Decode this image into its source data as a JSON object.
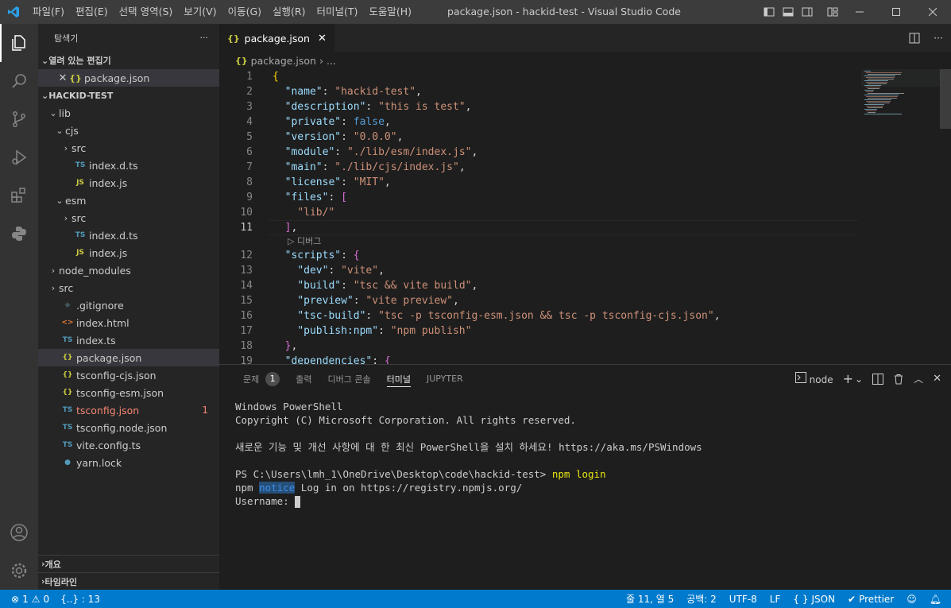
{
  "titlebar": {
    "title": "package.json - hackid-test - Visual Studio Code",
    "menu": [
      "파일(F)",
      "편집(E)",
      "선택 영역(S)",
      "보기(V)",
      "이동(G)",
      "실행(R)",
      "터미널(T)",
      "도움말(H)"
    ]
  },
  "sidebar": {
    "header": "탐색기",
    "more": "···",
    "open_editors_title": "열려 있는 편집기",
    "open_editor_item": "package.json",
    "workspace_title": "HACKID-TEST",
    "tree": [
      {
        "label": "lib",
        "kind": "folder-open",
        "depth": 0
      },
      {
        "label": "cjs",
        "kind": "folder-open",
        "depth": 1
      },
      {
        "label": "src",
        "kind": "folder",
        "depth": 2
      },
      {
        "label": "index.d.ts",
        "kind": "ts",
        "depth": 2
      },
      {
        "label": "index.js",
        "kind": "js",
        "depth": 2
      },
      {
        "label": "esm",
        "kind": "folder-open",
        "depth": 1
      },
      {
        "label": "src",
        "kind": "folder",
        "depth": 2
      },
      {
        "label": "index.d.ts",
        "kind": "ts",
        "depth": 2
      },
      {
        "label": "index.js",
        "kind": "js",
        "depth": 2
      },
      {
        "label": "node_modules",
        "kind": "folder",
        "depth": 0
      },
      {
        "label": "src",
        "kind": "folder",
        "depth": 0
      },
      {
        "label": ".gitignore",
        "kind": "git",
        "depth": 0
      },
      {
        "label": "index.html",
        "kind": "html",
        "depth": 0
      },
      {
        "label": "index.ts",
        "kind": "ts",
        "depth": 0
      },
      {
        "label": "package.json",
        "kind": "json",
        "depth": 0,
        "selected": true
      },
      {
        "label": "tsconfig-cjs.json",
        "kind": "json",
        "depth": 0
      },
      {
        "label": "tsconfig-esm.json",
        "kind": "json",
        "depth": 0
      },
      {
        "label": "tsconfig.json",
        "kind": "tsconfig",
        "depth": 0,
        "error": "1"
      },
      {
        "label": "tsconfig.node.json",
        "kind": "tsconfig",
        "depth": 0
      },
      {
        "label": "vite.config.ts",
        "kind": "ts",
        "depth": 0
      },
      {
        "label": "yarn.lock",
        "kind": "yarn",
        "depth": 0
      }
    ],
    "outline_title": "개요",
    "timeline_title": "타임라인"
  },
  "editor": {
    "tab_label": "package.json",
    "breadcrumb_file": "package.json",
    "breadcrumb_more": "...",
    "codelens": "디버그",
    "current_line": 11,
    "lines": [
      {
        "n": "1",
        "html": "<span class=\"br1\">{</span>"
      },
      {
        "n": "2",
        "html": "  <span class=\"k\">\"name\"</span><span class=\"p\">: </span><span class=\"s\">\"hackid-test\"</span><span class=\"p\">,</span>"
      },
      {
        "n": "3",
        "html": "  <span class=\"k\">\"description\"</span><span class=\"p\">: </span><span class=\"s\">\"this is test\"</span><span class=\"p\">,</span>"
      },
      {
        "n": "4",
        "html": "  <span class=\"k\">\"private\"</span><span class=\"p\">: </span><span class=\"b\">false</span><span class=\"p\">,</span>"
      },
      {
        "n": "5",
        "html": "  <span class=\"k\">\"version\"</span><span class=\"p\">: </span><span class=\"s\">\"0.0.0\"</span><span class=\"p\">,</span>"
      },
      {
        "n": "6",
        "html": "  <span class=\"k\">\"module\"</span><span class=\"p\">: </span><span class=\"s\">\"./lib/esm/index.js\"</span><span class=\"p\">,</span>"
      },
      {
        "n": "7",
        "html": "  <span class=\"k\">\"main\"</span><span class=\"p\">: </span><span class=\"s\">\"./lib/cjs/index.js\"</span><span class=\"p\">,</span>"
      },
      {
        "n": "8",
        "html": "  <span class=\"k\">\"license\"</span><span class=\"p\">: </span><span class=\"s\">\"MIT\"</span><span class=\"p\">,</span>"
      },
      {
        "n": "9",
        "html": "  <span class=\"k\">\"files\"</span><span class=\"p\">: </span><span class=\"br2\">[</span>"
      },
      {
        "n": "10",
        "html": "    <span class=\"s\">\"lib/\"</span>"
      },
      {
        "n": "11",
        "html": "  <span class=\"br2\">]</span><span class=\"p\">,</span>"
      },
      {
        "n": "12",
        "html": "  <span class=\"k\">\"scripts\"</span><span class=\"p\">: </span><span class=\"br2\">{</span>"
      },
      {
        "n": "13",
        "html": "    <span class=\"k\">\"dev\"</span><span class=\"p\">: </span><span class=\"s\">\"vite\"</span><span class=\"p\">,</span>"
      },
      {
        "n": "14",
        "html": "    <span class=\"k\">\"build\"</span><span class=\"p\">: </span><span class=\"s\">\"tsc &amp;&amp; vite build\"</span><span class=\"p\">,</span>"
      },
      {
        "n": "15",
        "html": "    <span class=\"k\">\"preview\"</span><span class=\"p\">: </span><span class=\"s\">\"vite preview\"</span><span class=\"p\">,</span>"
      },
      {
        "n": "16",
        "html": "    <span class=\"k\">\"tsc-build\"</span><span class=\"p\">: </span><span class=\"s\">\"tsc -p tsconfig-esm.json &amp;&amp; tsc -p tsconfig-cjs.json\"</span><span class=\"p\">,</span>"
      },
      {
        "n": "17",
        "html": "    <span class=\"k\">\"publish:npm\"</span><span class=\"p\">: </span><span class=\"s\">\"npm publish\"</span>"
      },
      {
        "n": "18",
        "html": "  <span class=\"br2\">}</span><span class=\"p\">,</span>"
      },
      {
        "n": "19",
        "html": "  <span class=\"k\">\"dependencies\"</span><span class=\"p\">: </span><span class=\"br2\">{</span>"
      }
    ]
  },
  "panel": {
    "tabs": [
      "문제",
      "출력",
      "디버그 콘솔",
      "터미널",
      "JUPYTER"
    ],
    "problems_count": "1",
    "active_tab": "터미널",
    "terminal_name": "node",
    "terminal": {
      "line1": "Windows PowerShell",
      "line2": "Copyright (C) Microsoft Corporation. All rights reserved.",
      "line3": "새로운 기능 및 개선 사항에 대 한 최신 PowerShell을 설치 하세요! https://aka.ms/PSWindows",
      "prompt": "PS C:\\Users\\lmh_1\\OneDrive\\Desktop\\code\\hackid-test> ",
      "command": "npm login",
      "npm_prefix": "npm ",
      "notice_word": "notice",
      "notice_text": " Log in on https://registry.npmjs.org/",
      "username_label": "Username: "
    }
  },
  "statusbar": {
    "errors": "1",
    "warnings": "0",
    "braces": "{..} : 13",
    "position": "줄 11, 열 5",
    "spaces": "공백: 2",
    "encoding": "UTF-8",
    "eol": "LF",
    "language": "JSON",
    "formatter": "Prettier"
  },
  "colors": {
    "accent": "#007acc",
    "titlebar": "#3c3c3c",
    "sidebar": "#252526",
    "editor": "#1e1e1e"
  }
}
